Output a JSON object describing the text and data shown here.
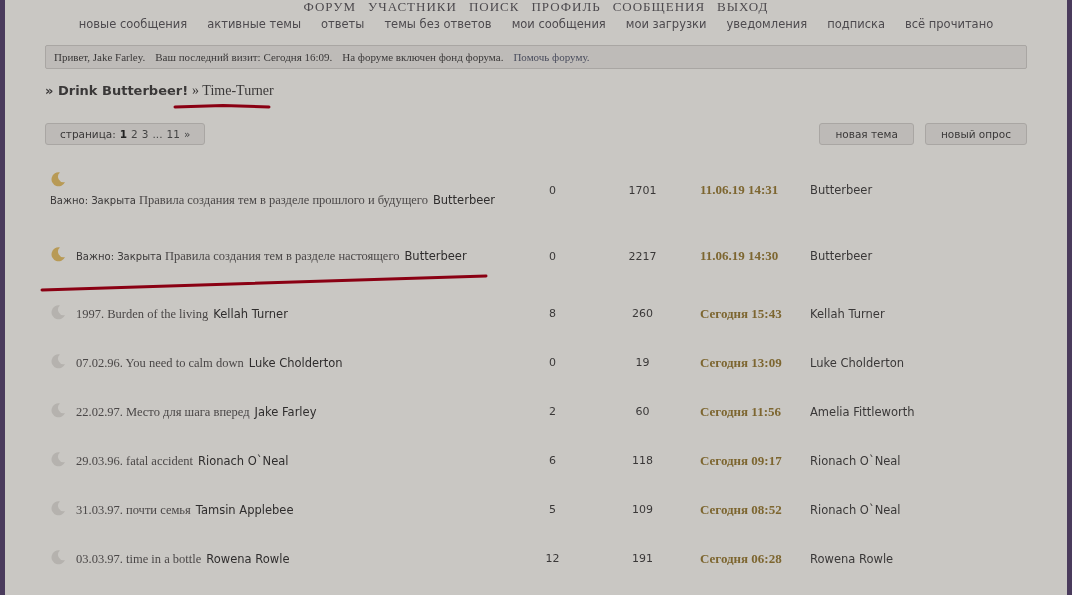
{
  "main_menu": [
    "ФОРУМ",
    "УЧАСТНИКИ",
    "ПОИСК",
    "ПРОФИЛЬ",
    "СООБЩЕНИЯ",
    "ВЫХОД"
  ],
  "sub_menu": [
    "новые сообщения",
    "активные темы",
    "ответы",
    "темы без ответов",
    "мои сообщения",
    "мои загрузки",
    "уведомления",
    "подписка",
    "всё прочитано"
  ],
  "welcome": {
    "greeting": "Привет, Jake Farley.",
    "last_visit": "Ваш последний визит: Сегодня 16:09.",
    "fund": "На форуме включен фонд форума.",
    "help_link": "Помочь форуму."
  },
  "breadcrumb": {
    "parent": "» Drink Butterbeer!",
    "current": "» Time-Turner",
    "underlined": true
  },
  "pagination": {
    "label": "страница:",
    "pages": [
      {
        "label": "1",
        "selected": true
      },
      {
        "label": "2",
        "selected": false
      },
      {
        "label": "3",
        "selected": false
      },
      {
        "label": "...",
        "selected": false
      },
      {
        "label": "11",
        "selected": false
      },
      {
        "label": "»",
        "selected": false
      }
    ]
  },
  "buttons": [
    "новая тема",
    "новый опрос"
  ],
  "topics": [
    {
      "important": true,
      "prefix": "Важно: Закрыта",
      "title": "Правила создания тем в разделе прошлого и будущего",
      "author": "Butterbeer",
      "replies": "0",
      "views": "1701",
      "last_date": "11.06.19 14:31",
      "last_author": "Butterbeer",
      "underlined": false
    },
    {
      "important": true,
      "prefix": "Важно: Закрыта",
      "title": "Правила создания тем в разделе настоящего",
      "author": "Butterbeer",
      "replies": "0",
      "views": "2217",
      "last_date": "11.06.19 14:30",
      "last_author": "Butterbeer",
      "underlined": true
    },
    {
      "important": false,
      "title": "1997. Burden of the living",
      "author": "Kellah Turner",
      "replies": "8",
      "views": "260",
      "last_date": "Сегодня 15:43",
      "last_author": "Kellah Turner",
      "underlined": false
    },
    {
      "important": false,
      "title": "07.02.96. You need to calm down",
      "author": "Luke Cholderton",
      "replies": "0",
      "views": "19",
      "last_date": "Сегодня 13:09",
      "last_author": "Luke Cholderton",
      "underlined": false
    },
    {
      "important": false,
      "title": "22.02.97. Место для шага вперед",
      "author": "Jake Farley",
      "replies": "2",
      "views": "60",
      "last_date": "Сегодня 11:56",
      "last_author": "Amelia Fittleworth",
      "underlined": false
    },
    {
      "important": false,
      "title": "29.03.96. fatal accident",
      "author": "Rionach O`Neal",
      "replies": "6",
      "views": "118",
      "last_date": "Сегодня 09:17",
      "last_author": "Rionach O`Neal",
      "underlined": false
    },
    {
      "important": false,
      "title": "31.03.97. почти семья",
      "author": "Tamsin Applebee",
      "replies": "5",
      "views": "109",
      "last_date": "Сегодня 08:52",
      "last_author": "Rionach O`Neal",
      "underlined": false
    },
    {
      "important": false,
      "title": "03.03.97. time in a bottle",
      "author": "Rowena Rowle",
      "replies": "12",
      "views": "191",
      "last_date": "Сегодня 06:28",
      "last_author": "Rowena Rowle",
      "underlined": false
    }
  ]
}
